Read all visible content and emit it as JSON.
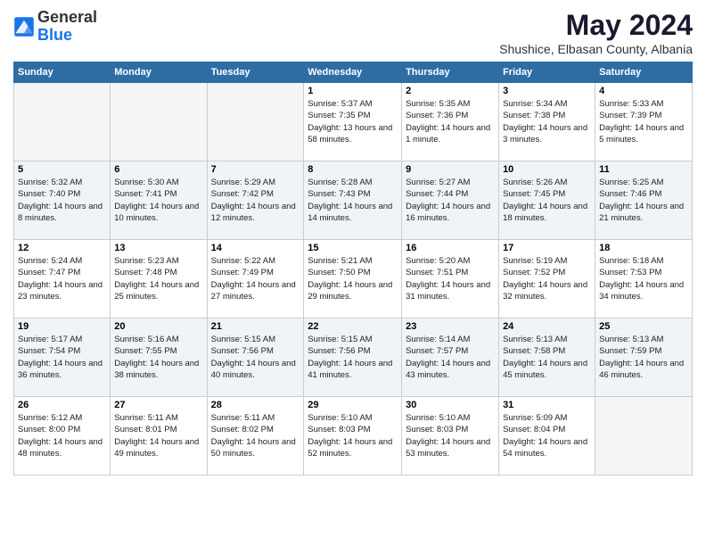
{
  "logo": {
    "general": "General",
    "blue": "Blue"
  },
  "title": "May 2024",
  "subtitle": "Shushice, Elbasan County, Albania",
  "days": [
    "Sunday",
    "Monday",
    "Tuesday",
    "Wednesday",
    "Thursday",
    "Friday",
    "Saturday"
  ],
  "weeks": [
    [
      {
        "num": "",
        "empty": true
      },
      {
        "num": "",
        "empty": true
      },
      {
        "num": "",
        "empty": true
      },
      {
        "num": "1",
        "sunrise": "5:37 AM",
        "sunset": "7:35 PM",
        "daylight": "13 hours and 58 minutes."
      },
      {
        "num": "2",
        "sunrise": "5:35 AM",
        "sunset": "7:36 PM",
        "daylight": "14 hours and 1 minute."
      },
      {
        "num": "3",
        "sunrise": "5:34 AM",
        "sunset": "7:38 PM",
        "daylight": "14 hours and 3 minutes."
      },
      {
        "num": "4",
        "sunrise": "5:33 AM",
        "sunset": "7:39 PM",
        "daylight": "14 hours and 5 minutes."
      }
    ],
    [
      {
        "num": "5",
        "sunrise": "5:32 AM",
        "sunset": "7:40 PM",
        "daylight": "14 hours and 8 minutes."
      },
      {
        "num": "6",
        "sunrise": "5:30 AM",
        "sunset": "7:41 PM",
        "daylight": "14 hours and 10 minutes."
      },
      {
        "num": "7",
        "sunrise": "5:29 AM",
        "sunset": "7:42 PM",
        "daylight": "14 hours and 12 minutes."
      },
      {
        "num": "8",
        "sunrise": "5:28 AM",
        "sunset": "7:43 PM",
        "daylight": "14 hours and 14 minutes."
      },
      {
        "num": "9",
        "sunrise": "5:27 AM",
        "sunset": "7:44 PM",
        "daylight": "14 hours and 16 minutes."
      },
      {
        "num": "10",
        "sunrise": "5:26 AM",
        "sunset": "7:45 PM",
        "daylight": "14 hours and 18 minutes."
      },
      {
        "num": "11",
        "sunrise": "5:25 AM",
        "sunset": "7:46 PM",
        "daylight": "14 hours and 21 minutes."
      }
    ],
    [
      {
        "num": "12",
        "sunrise": "5:24 AM",
        "sunset": "7:47 PM",
        "daylight": "14 hours and 23 minutes."
      },
      {
        "num": "13",
        "sunrise": "5:23 AM",
        "sunset": "7:48 PM",
        "daylight": "14 hours and 25 minutes."
      },
      {
        "num": "14",
        "sunrise": "5:22 AM",
        "sunset": "7:49 PM",
        "daylight": "14 hours and 27 minutes."
      },
      {
        "num": "15",
        "sunrise": "5:21 AM",
        "sunset": "7:50 PM",
        "daylight": "14 hours and 29 minutes."
      },
      {
        "num": "16",
        "sunrise": "5:20 AM",
        "sunset": "7:51 PM",
        "daylight": "14 hours and 31 minutes."
      },
      {
        "num": "17",
        "sunrise": "5:19 AM",
        "sunset": "7:52 PM",
        "daylight": "14 hours and 32 minutes."
      },
      {
        "num": "18",
        "sunrise": "5:18 AM",
        "sunset": "7:53 PM",
        "daylight": "14 hours and 34 minutes."
      }
    ],
    [
      {
        "num": "19",
        "sunrise": "5:17 AM",
        "sunset": "7:54 PM",
        "daylight": "14 hours and 36 minutes."
      },
      {
        "num": "20",
        "sunrise": "5:16 AM",
        "sunset": "7:55 PM",
        "daylight": "14 hours and 38 minutes."
      },
      {
        "num": "21",
        "sunrise": "5:15 AM",
        "sunset": "7:56 PM",
        "daylight": "14 hours and 40 minutes."
      },
      {
        "num": "22",
        "sunrise": "5:15 AM",
        "sunset": "7:56 PM",
        "daylight": "14 hours and 41 minutes."
      },
      {
        "num": "23",
        "sunrise": "5:14 AM",
        "sunset": "7:57 PM",
        "daylight": "14 hours and 43 minutes."
      },
      {
        "num": "24",
        "sunrise": "5:13 AM",
        "sunset": "7:58 PM",
        "daylight": "14 hours and 45 minutes."
      },
      {
        "num": "25",
        "sunrise": "5:13 AM",
        "sunset": "7:59 PM",
        "daylight": "14 hours and 46 minutes."
      }
    ],
    [
      {
        "num": "26",
        "sunrise": "5:12 AM",
        "sunset": "8:00 PM",
        "daylight": "14 hours and 48 minutes."
      },
      {
        "num": "27",
        "sunrise": "5:11 AM",
        "sunset": "8:01 PM",
        "daylight": "14 hours and 49 minutes."
      },
      {
        "num": "28",
        "sunrise": "5:11 AM",
        "sunset": "8:02 PM",
        "daylight": "14 hours and 50 minutes."
      },
      {
        "num": "29",
        "sunrise": "5:10 AM",
        "sunset": "8:03 PM",
        "daylight": "14 hours and 52 minutes."
      },
      {
        "num": "30",
        "sunrise": "5:10 AM",
        "sunset": "8:03 PM",
        "daylight": "14 hours and 53 minutes."
      },
      {
        "num": "31",
        "sunrise": "5:09 AM",
        "sunset": "8:04 PM",
        "daylight": "14 hours and 54 minutes."
      },
      {
        "num": "",
        "empty": true
      }
    ]
  ]
}
